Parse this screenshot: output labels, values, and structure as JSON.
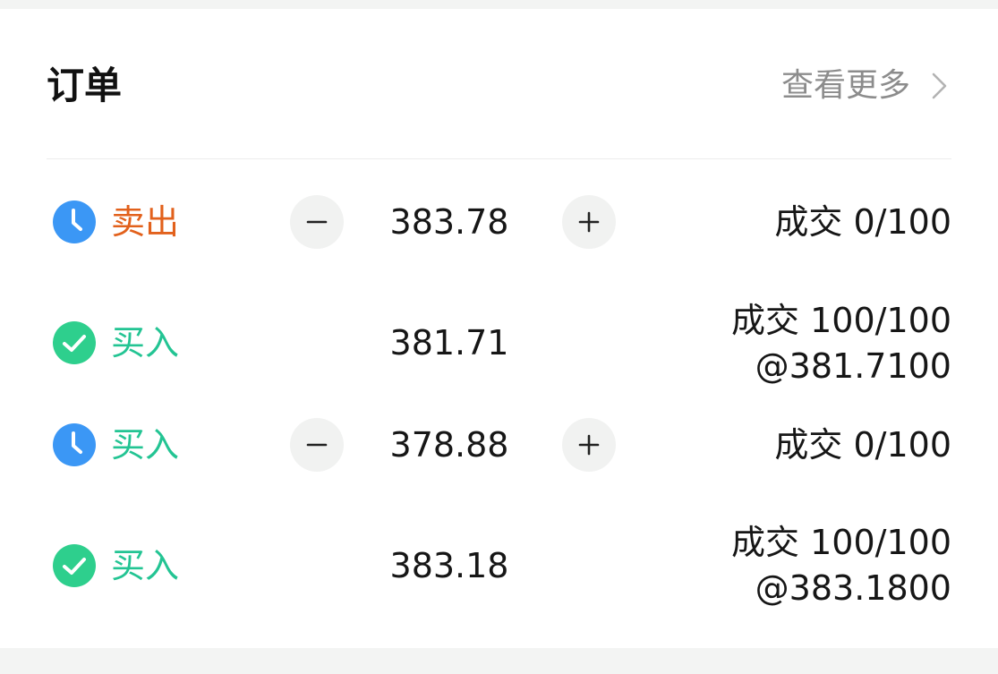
{
  "header": {
    "title": "订单",
    "more_label": "查看更多"
  },
  "orders": [
    {
      "status_icon": "clock-icon",
      "side": "卖出",
      "side_color": "#e2611c",
      "price": "383.78",
      "fill_line1": "成交 0/100",
      "fill_line2": ""
    },
    {
      "status_icon": "check-icon",
      "side": "买入",
      "side_color": "#23c493",
      "price": "381.71",
      "fill_line1": "成交 100/100",
      "fill_line2": "@381.7100"
    },
    {
      "status_icon": "clock-icon",
      "side": "买入",
      "side_color": "#23c493",
      "price": "378.88",
      "fill_line1": "成交 0/100",
      "fill_line2": ""
    },
    {
      "status_icon": "check-icon",
      "side": "买入",
      "side_color": "#23c493",
      "price": "383.18",
      "fill_line1": "成交 100/100",
      "fill_line2": "@383.1800"
    }
  ],
  "colors": {
    "pending_blue": "#3b97f5",
    "filled_green": "#2ecf8d",
    "sell_orange": "#e2611c",
    "buy_green": "#23c493"
  }
}
